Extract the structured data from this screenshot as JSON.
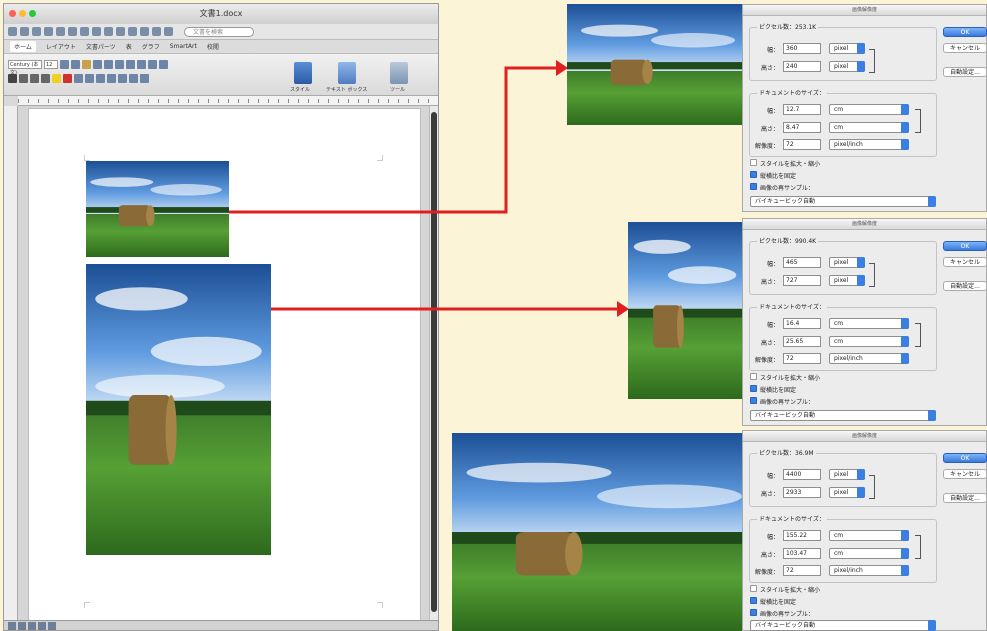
{
  "word": {
    "title": "文書1.docx",
    "search_placeholder": "文書を検索",
    "tabs": [
      "ホーム",
      "レイアウト",
      "文書パーツ",
      "表",
      "グラフ",
      "SmartArt",
      "校閲"
    ],
    "font_name": "Century (本文)",
    "font_size": "12",
    "ribbon_labels": [
      "スタイル",
      "テキスト ボックス",
      "ツール"
    ]
  },
  "dialogs": [
    {
      "title": "画像解像度",
      "pixel_dims": "ピクセル数：253.1K",
      "width_label": "幅：",
      "width": "360",
      "height_label": "高さ：",
      "height": "240",
      "pixel_unit": "pixel",
      "doc_size": "ドキュメントのサイズ：",
      "doc_width": "12.7",
      "doc_height": "8.47",
      "cm_unit": "cm",
      "res_label": "解像度：",
      "resolution": "72",
      "res_unit": "pixel/inch",
      "scale_styles": "スタイルを拡大・縮小",
      "constrain": "縦横比を固定",
      "resample": "画像の再サンプル：",
      "method": "バイキュービック自動",
      "ok": "OK",
      "cancel": "キャンセル",
      "auto": "自動設定..."
    },
    {
      "title": "画像解像度",
      "pixel_dims": "ピクセル数：990.4K",
      "width_label": "幅：",
      "width": "465",
      "height_label": "高さ：",
      "height": "727",
      "pixel_unit": "pixel",
      "doc_size": "ドキュメントのサイズ：",
      "doc_width": "16.4",
      "doc_height": "25.65",
      "cm_unit": "cm",
      "res_label": "解像度：",
      "resolution": "72",
      "res_unit": "pixel/inch",
      "scale_styles": "スタイルを拡大・縮小",
      "constrain": "縦横比を固定",
      "resample": "画像の再サンプル：",
      "method": "バイキュービック自動",
      "ok": "OK",
      "cancel": "キャンセル",
      "auto": "自動設定..."
    },
    {
      "title": "画像解像度",
      "pixel_dims": "ピクセル数：36.9M",
      "width_label": "幅：",
      "width": "4400",
      "height_label": "高さ：",
      "height": "2933",
      "pixel_unit": "pixel",
      "doc_size": "ドキュメントのサイズ：",
      "doc_width": "155.22",
      "doc_height": "103.47",
      "cm_unit": "cm",
      "res_label": "解像度：",
      "resolution": "72",
      "res_unit": "pixel/inch",
      "scale_styles": "スタイルを拡大・縮小",
      "constrain": "縦横比を固定",
      "resample": "画像の再サンプル：",
      "method": "バイキュービック自動",
      "ok": "OK",
      "cancel": "キャンセル",
      "auto": "自動設定..."
    }
  ],
  "colors": {
    "background": "#fbf4d6",
    "arrow": "#e02020",
    "accent": "#3b7fe0"
  }
}
